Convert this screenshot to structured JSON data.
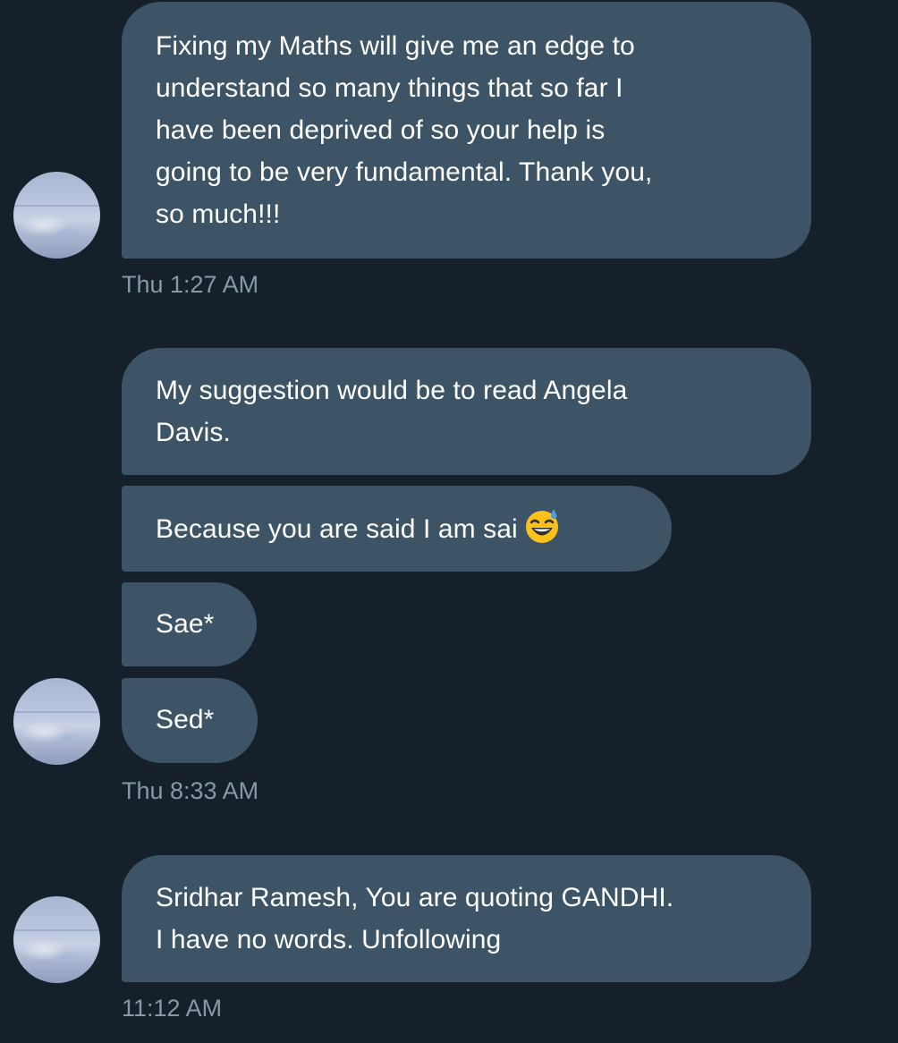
{
  "messages": {
    "m1": {
      "lines": [
        "Fixing my Maths will give me an edge to",
        "understand so many things that so far I",
        "have been deprived of so your help is",
        "going to be very fundamental. Thank you,",
        "so much!!!"
      ]
    },
    "m2": {
      "lines": [
        "My suggestion would be to read Angela",
        "Davis."
      ]
    },
    "m3": {
      "text": "Because you are said I am sai",
      "emoji": "grinning-face-with-sweat-icon"
    },
    "m4": {
      "text": "Sae*"
    },
    "m5": {
      "text": "Sed*"
    },
    "m6": {
      "lines": [
        "Sridhar Ramesh, You are quoting GANDHI.",
        "I have no words. Unfollowing"
      ]
    }
  },
  "timestamps": {
    "t1": "Thu 1:27 AM",
    "t2": "Thu 8:33 AM",
    "t3": "11:12 AM"
  },
  "colors": {
    "background": "#15202b",
    "bubble": "#3d5466",
    "timestamp": "#8899a6",
    "text": "#ffffff"
  }
}
